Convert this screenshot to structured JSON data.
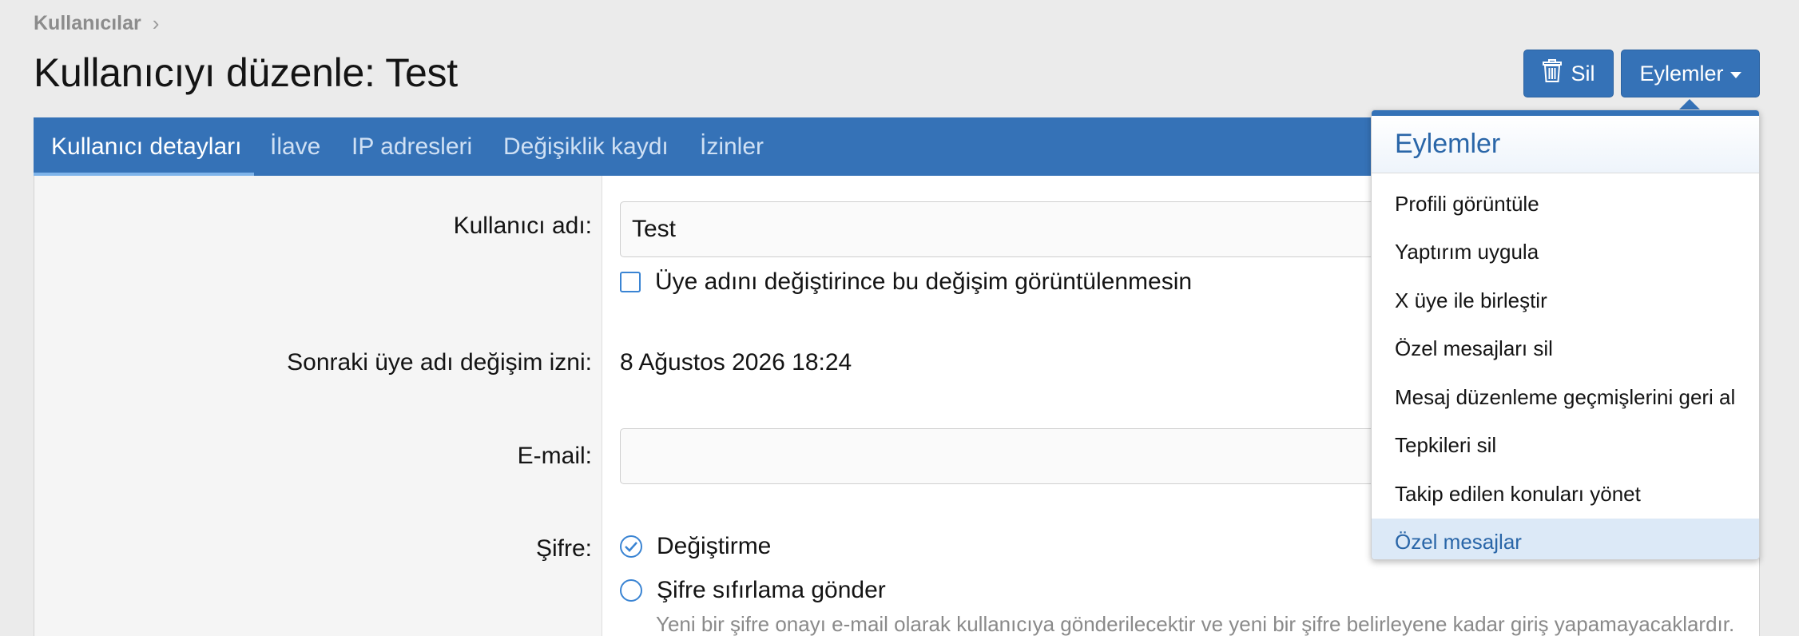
{
  "breadcrumb": {
    "label": "Kullanıcılar",
    "chevron": "›"
  },
  "page": {
    "title": "Kullanıcıyı düzenle: Test"
  },
  "toolbar": {
    "delete_label": "Sil",
    "delete_icon": "trash-icon",
    "actions_label": "Eylemler"
  },
  "colors": {
    "accent": "#3572b7",
    "menu_selected_bg": "#dce9f7",
    "menu_title": "#2a66a8"
  },
  "tabs": [
    {
      "label": "Kullanıcı detayları",
      "active": true
    },
    {
      "label": "İlave"
    },
    {
      "label": "IP adresleri"
    },
    {
      "label": "Değişiklik kaydı"
    },
    {
      "label": "İzinler"
    }
  ],
  "form": {
    "username": {
      "label": "Kullanıcı adı:",
      "value": "Test"
    },
    "hide_change": {
      "label": "Üye adını değiştirince bu değişim görüntülenmesin",
      "checked": false
    },
    "next_change": {
      "label": "Sonraki üye adı değişim izni:",
      "value": "8 Ağustos 2026 18:24"
    },
    "email": {
      "label": "E-mail:",
      "value": ""
    },
    "password": {
      "label": "Şifre:",
      "options": [
        {
          "label": "Değiştirme",
          "selected": true
        },
        {
          "label": "Şifre sıfırlama gönder",
          "selected": false
        }
      ],
      "hint": "Yeni bir şifre onayı e-mail olarak kullanıcıya gönderilecektir ve yeni bir şifre belirleyene kadar giriş yapamayacaklardır."
    }
  },
  "actions_menu": {
    "title": "Eylemler",
    "items": [
      {
        "label": "Profili görüntüle"
      },
      {
        "label": "Yaptırım uygula"
      },
      {
        "label": "X üye ile birleştir"
      },
      {
        "label": "Özel mesajları sil"
      },
      {
        "label": "Mesaj düzenleme geçmişlerini geri al"
      },
      {
        "label": "Tepkileri sil"
      },
      {
        "label": "Takip edilen konuları yönet"
      },
      {
        "label": "Özel mesajlar",
        "selected": true
      }
    ]
  }
}
